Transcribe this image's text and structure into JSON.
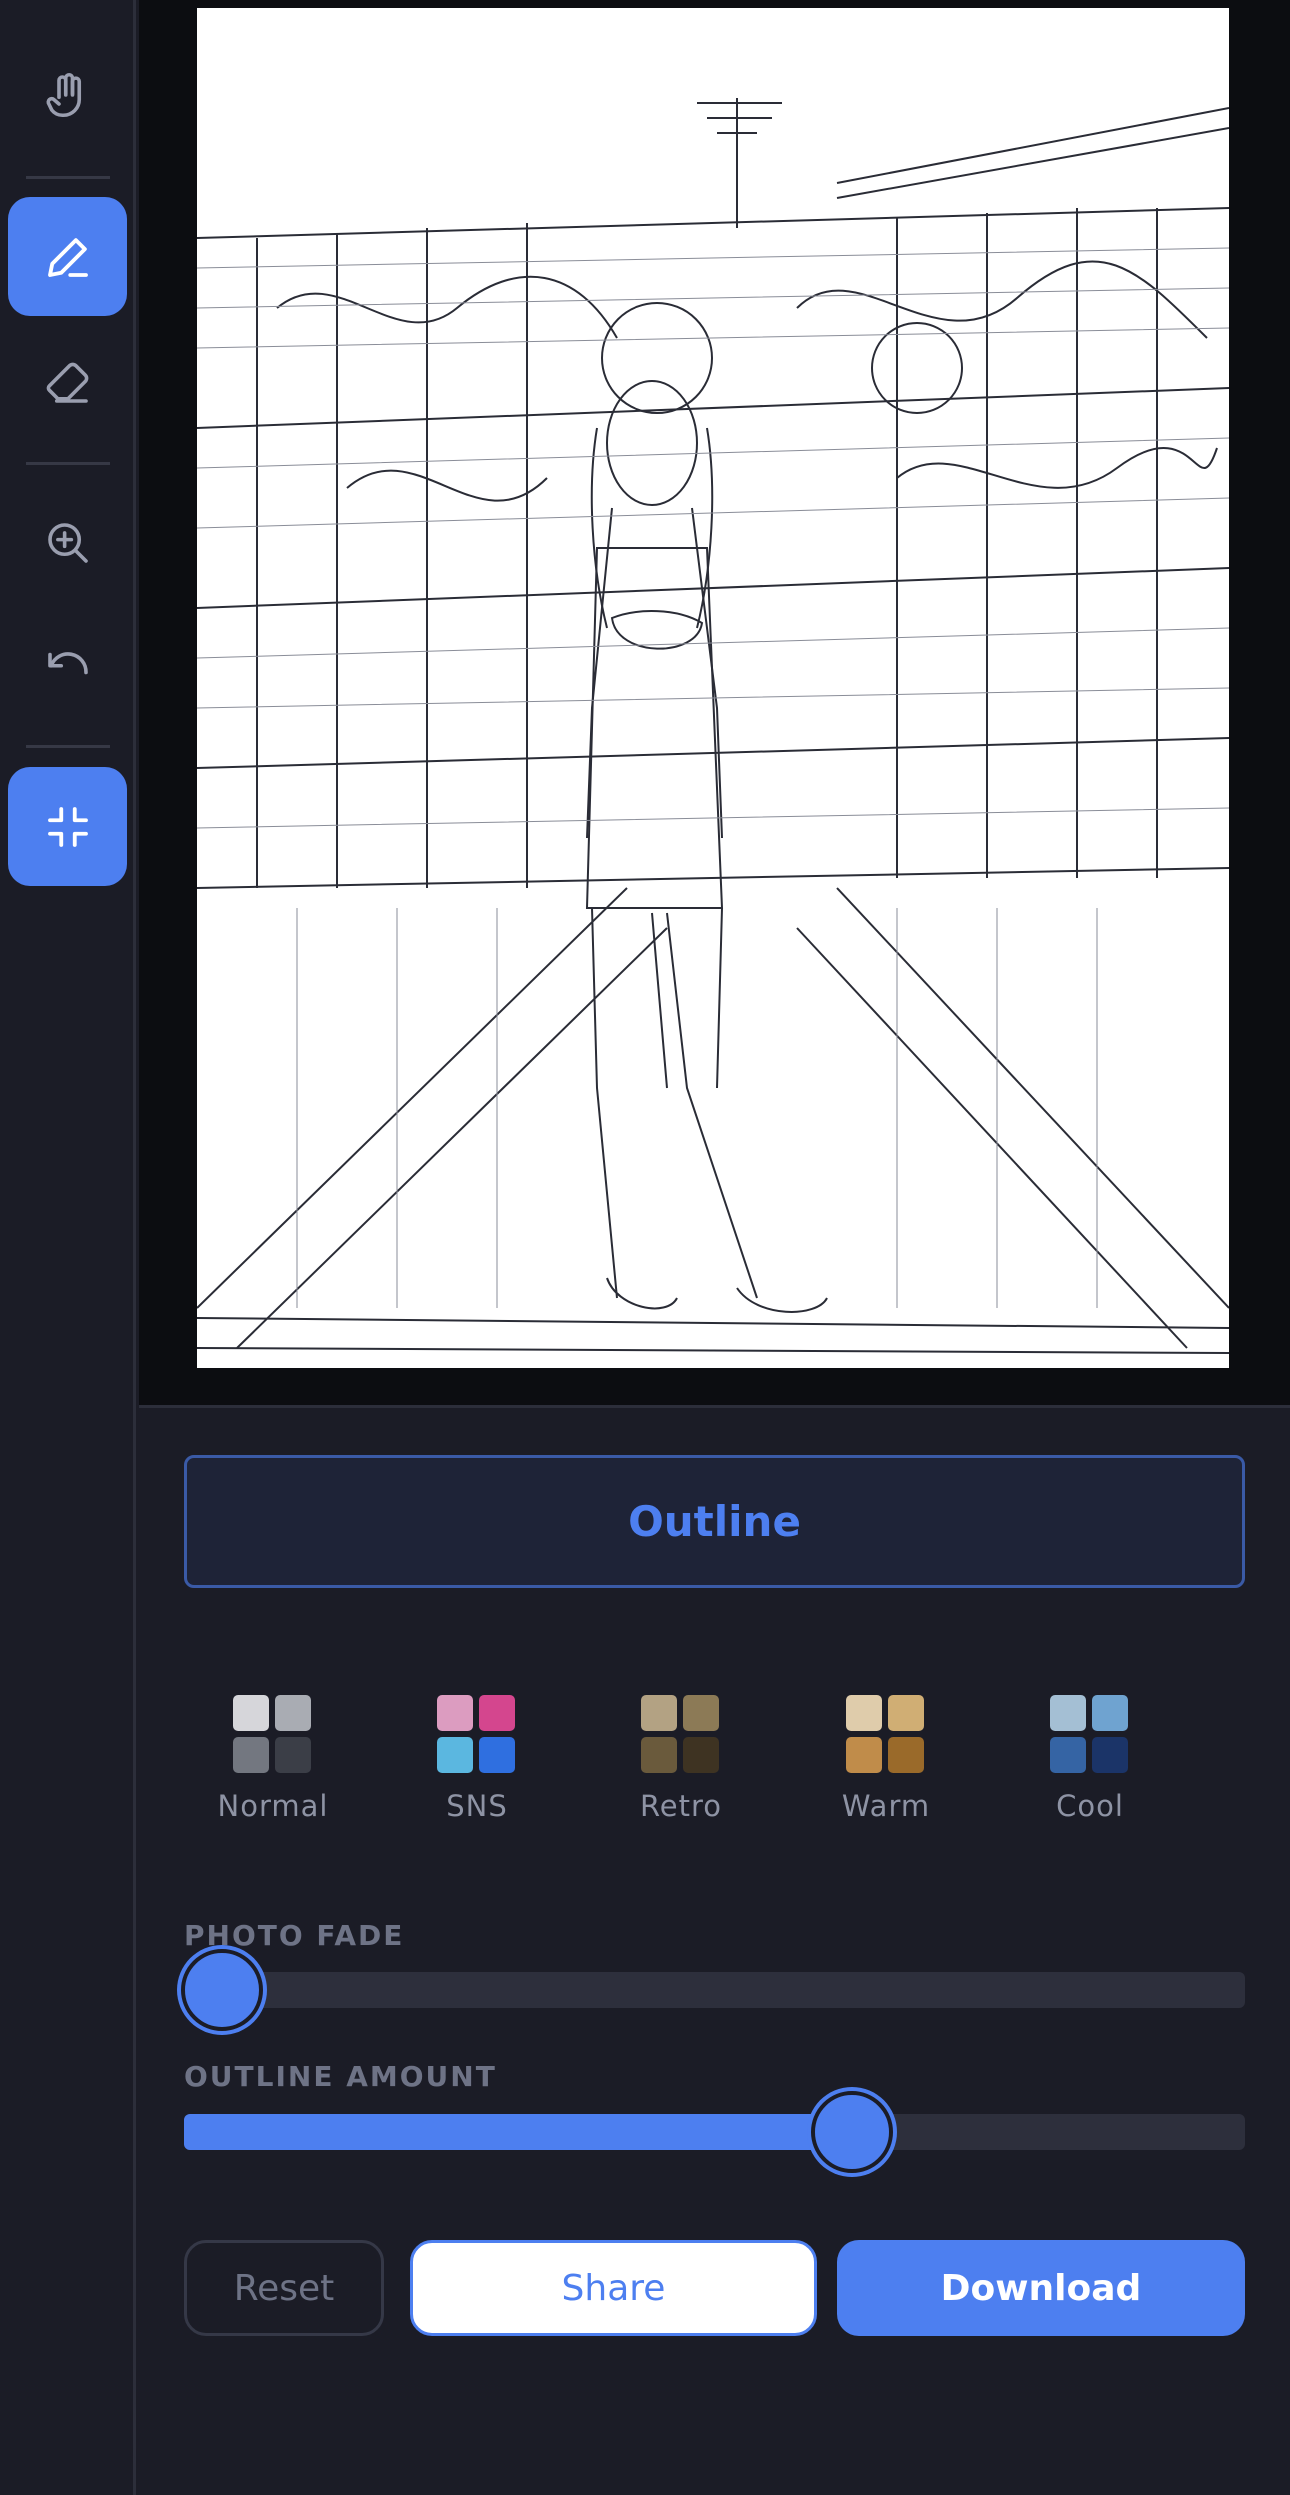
{
  "sidebar": {
    "tools": [
      {
        "name": "hand-icon",
        "active": false
      },
      {
        "name": "pencil-icon",
        "active": true
      },
      {
        "name": "eraser-icon",
        "active": false
      },
      {
        "name": "zoom-in-icon",
        "active": false
      },
      {
        "name": "undo-icon",
        "active": false
      },
      {
        "name": "collapse-icon",
        "active": true
      }
    ]
  },
  "mode": {
    "label": "Outline"
  },
  "presets": [
    {
      "label": "Normal",
      "colors": [
        "#d6d6da",
        "#a9acb3",
        "#737780",
        "#3b3e47"
      ]
    },
    {
      "label": "SNS",
      "colors": [
        "#dc9cc0",
        "#d4468e",
        "#5bb7e0",
        "#2f6fe0"
      ]
    },
    {
      "label": "Retro",
      "colors": [
        "#b3a283",
        "#8c7a56",
        "#6a5a3c",
        "#3e3322"
      ]
    },
    {
      "label": "Warm",
      "colors": [
        "#dfccab",
        "#d0ae74",
        "#c08c4a",
        "#9a6a2a"
      ]
    },
    {
      "label": "Cool",
      "colors": [
        "#a4bfd4",
        "#6fa3d0",
        "#3564a4",
        "#1b3468"
      ]
    }
  ],
  "sliders": {
    "photo_fade": {
      "label": "PHOTO FADE",
      "value": 0.0
    },
    "outline_amount": {
      "label": "OUTLINE AMOUNT",
      "value": 0.64
    }
  },
  "actions": {
    "reset_label": "Reset",
    "share_label": "Share",
    "download_label": "Download"
  },
  "colors": {
    "accent": "#4d7ff0",
    "background": "#1b1c26",
    "canvas_bg": "#0c0d11"
  }
}
